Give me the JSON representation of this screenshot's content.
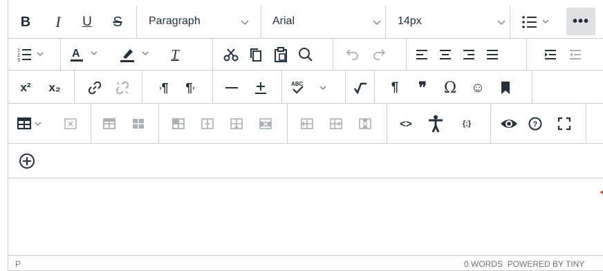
{
  "toolbar": {
    "block_format": "Paragraph",
    "font_family": "Arial",
    "font_size": "14px",
    "more_label": "•••",
    "icons": {
      "bold": "B",
      "italic": "I",
      "underline": "U",
      "strikethrough": "S",
      "clear_format": "T",
      "superscript": "x²",
      "subscript": "x₂",
      "ltr": "¶",
      "rtl": "¶",
      "pilcrow": "¶",
      "quote": "❞",
      "omega": "Ω",
      "emoji": "☺",
      "codesample": "<>",
      "accessibility": "†",
      "template": "{;}"
    }
  },
  "statusbar": {
    "path": "P",
    "word_count": "0 WORDS",
    "powered_by": "POWERED BY TINY"
  },
  "colors": {
    "border": "#cccccc",
    "icon": "#222f3e",
    "active_bg": "#dee0e2",
    "marker": "#e03e2d",
    "status_text": "#6d737b"
  }
}
